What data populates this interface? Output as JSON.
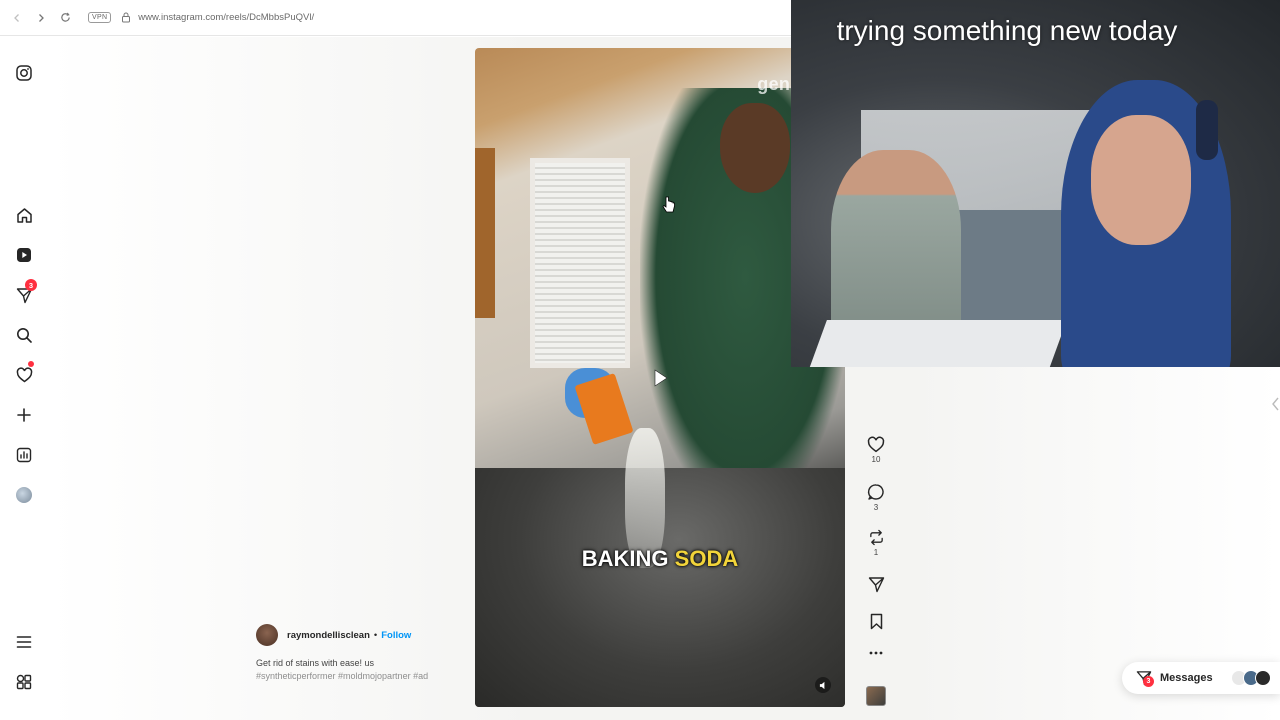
{
  "browser": {
    "vpn_label": "VPN",
    "url": "www.instagram.com/reels/DcMbbsPuQVl/"
  },
  "sidebar": {
    "items": [
      {
        "name": "instagram-logo-icon"
      },
      {
        "name": "home-icon"
      },
      {
        "name": "reels-icon"
      },
      {
        "name": "messages-icon",
        "badge": "3"
      },
      {
        "name": "search-icon"
      },
      {
        "name": "notifications-icon",
        "dot": true
      },
      {
        "name": "create-icon"
      },
      {
        "name": "dashboard-icon"
      },
      {
        "name": "profile-avatar"
      },
      {
        "name": "menu-icon"
      },
      {
        "name": "also-from-meta-icon"
      }
    ]
  },
  "reel": {
    "watermark": "genaicont",
    "overlay_text_1": "BAKING ",
    "overlay_text_2": "SODA",
    "author": "raymondellisclean",
    "separator": "•",
    "follow_label": "Follow",
    "description": "Get rid of stains with ease! us",
    "tags": "#syntheticperformer #moldmojopartner #ad",
    "likes": "10",
    "comments": "3",
    "reposts": "1"
  },
  "webcam": {
    "title": "trying something new today"
  },
  "messages_bar": {
    "label": "Messages",
    "badge": "3"
  },
  "colors": {
    "accent": "#0095f6",
    "badge": "#ff3040",
    "highlight": "#f2d43a"
  }
}
